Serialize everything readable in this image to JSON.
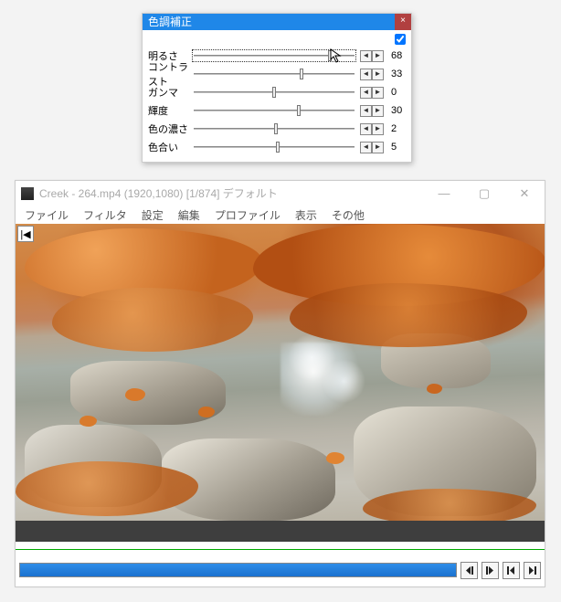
{
  "dialog": {
    "title": "色調補正",
    "enabled": true,
    "rows": [
      {
        "label": "明るさ",
        "value": 68,
        "min": -100,
        "max": 100,
        "focus": true
      },
      {
        "label": "コントラスト",
        "value": 33,
        "min": -100,
        "max": 100,
        "focus": false
      },
      {
        "label": "ガンマ",
        "value": 0,
        "min": -100,
        "max": 100,
        "focus": false
      },
      {
        "label": "輝度",
        "value": 30,
        "min": -100,
        "max": 100,
        "focus": false
      },
      {
        "label": "色の濃さ",
        "value": 2,
        "min": -100,
        "max": 100,
        "focus": false
      },
      {
        "label": "色合い",
        "value": 5,
        "min": -100,
        "max": 100,
        "focus": false
      }
    ],
    "arrow_left_glyph": "◄",
    "arrow_right_glyph": "►",
    "close_glyph": "×"
  },
  "player": {
    "title": "Creek - 264.mp4 (1920,1080)  [1/874]  デフォルト",
    "menu": [
      "ファイル",
      "フィルタ",
      "設定",
      "編集",
      "プロファイル",
      "表示",
      "その他"
    ],
    "winbtn_min": "—",
    "winbtn_max": "▢",
    "winbtn_close": "✕",
    "badge_glyph": "|◀",
    "progress_percent": 100,
    "transport_icons": [
      "step-back-icon",
      "step-fwd-icon",
      "goto-start-icon",
      "goto-end-icon"
    ]
  }
}
